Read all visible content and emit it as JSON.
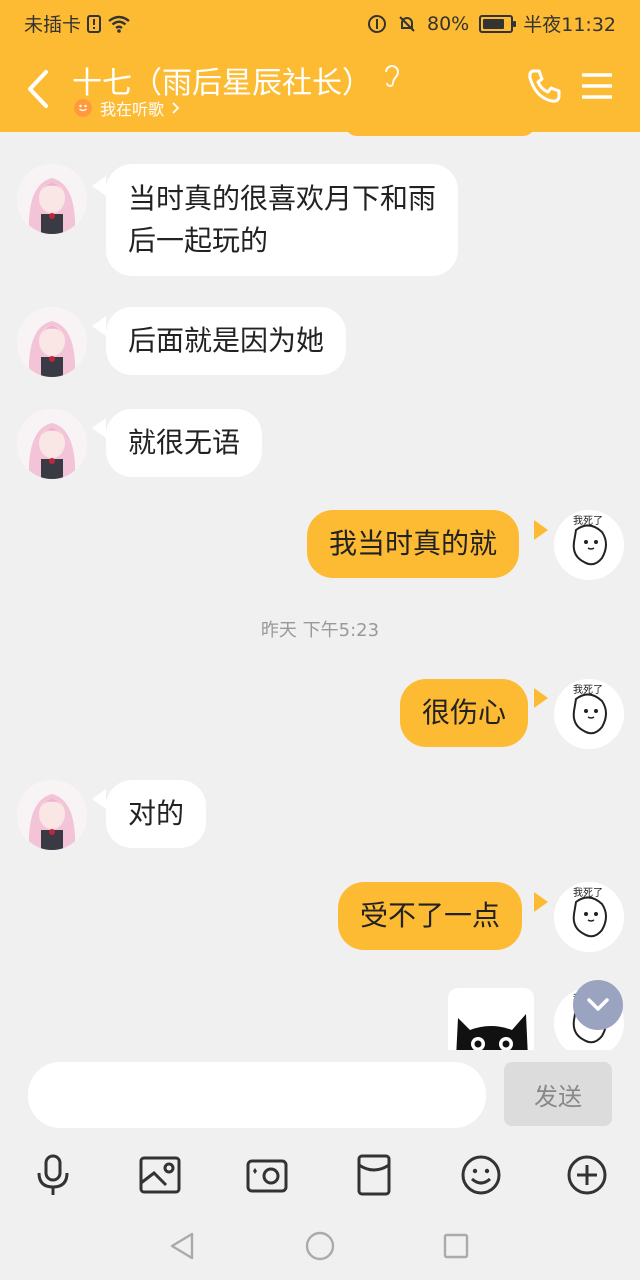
{
  "status_bar": {
    "carrier": "未插卡",
    "battery_percent": "80%",
    "time": "半夜11:32",
    "battery_level": 0.8
  },
  "header": {
    "title": "十七（雨后星辰社长）",
    "subtitle": "我在听歌",
    "back_icon": "chevron-left-icon",
    "call_icon": "phone-icon",
    "menu_icon": "menu-icon"
  },
  "messages": [
    {
      "side": "left",
      "text_lines": [
        "当时真的很喜欢月下和雨",
        "后一起玩的"
      ]
    },
    {
      "side": "left",
      "text": "后面就是因为她"
    },
    {
      "side": "left",
      "text": "就很无语"
    },
    {
      "side": "right",
      "text": "我当时真的就"
    },
    {
      "side": "right",
      "text": "很伤心"
    },
    {
      "side": "left",
      "text": "对的"
    },
    {
      "side": "right",
      "text": "受不了一点"
    }
  ],
  "timestamp": "昨天 下午5:23",
  "sticker_text": "我死了",
  "input": {
    "placeholder": "",
    "send_label": "发送"
  },
  "toolbar": [
    "microphone-icon",
    "image-icon",
    "camera-icon",
    "red-packet-icon",
    "emoji-icon",
    "plus-icon"
  ],
  "nav": [
    "back-nav-icon",
    "home-nav-icon",
    "recents-nav-icon"
  ]
}
